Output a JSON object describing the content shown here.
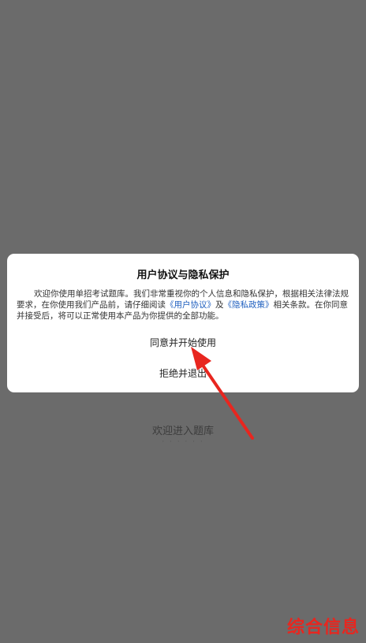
{
  "background": {
    "title": "欢迎进入题库",
    "subtitle": "· · · · · ·"
  },
  "dialog": {
    "title": "用户协议与隐私保护",
    "body_part1": "欢迎你使用单招考试题库。我们非常重视你的个人信息和隐私保护，根据相关法律法规要求，在你使用我们产品前，请仔细阅读",
    "link_user_agreement": "《用户协议》",
    "body_and": "及",
    "link_privacy_policy": "《隐私政策》",
    "body_part2": "相关条款。在你同意并接受后，将可以正常使用本产品为你提供的全部功能。",
    "agree_label": "同意并开始使用",
    "reject_label": "拒绝并退出"
  },
  "annotation": {
    "arrow_color": "#e8261f"
  },
  "watermark": {
    "text": "综合信息"
  }
}
